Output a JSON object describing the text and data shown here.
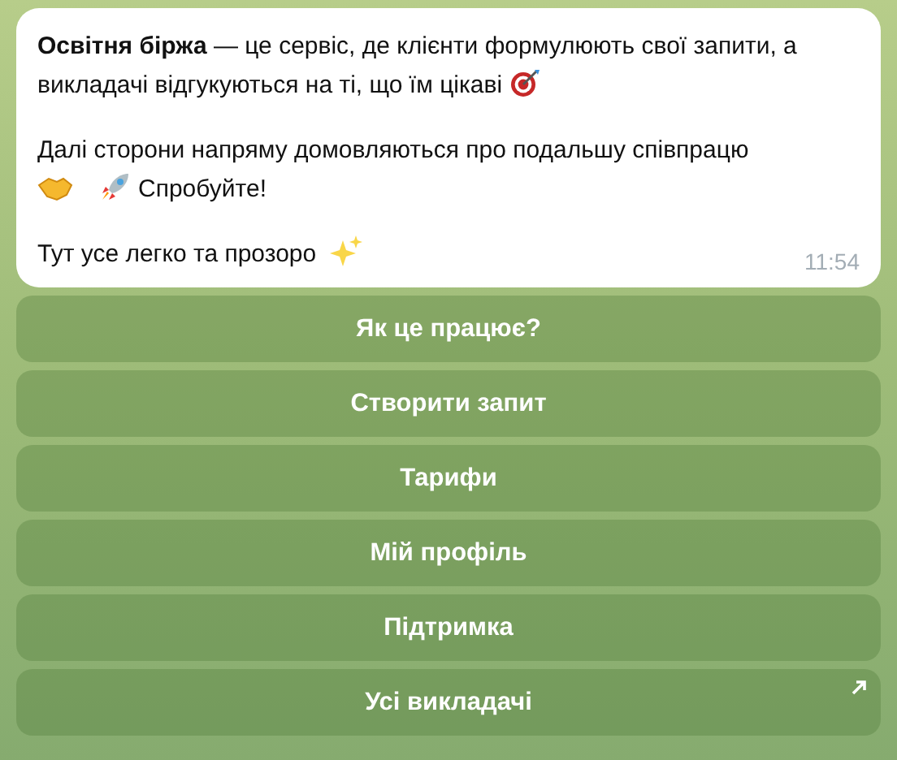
{
  "message": {
    "paragraphs": [
      {
        "text": "**Освітня біржа** — це сервіс, де клієнти формулюють свої запити, а викладачі відгукуються на ті, що їм цікаві"
      },
      {
        "text": "Далі сторони напряму домовляються про подальшу співпрацю",
        "tail": "Спробуйте!"
      },
      {
        "text": "Тут усе легко та прозоро"
      }
    ],
    "time": "11:54"
  },
  "buttons": [
    {
      "label": "Як це працює?",
      "kind": "callback"
    },
    {
      "label": "Створити запит",
      "kind": "callback"
    },
    {
      "label": "Тарифи",
      "kind": "callback"
    },
    {
      "label": "Мій профіль",
      "kind": "callback"
    },
    {
      "label": "Підтримка",
      "kind": "callback"
    },
    {
      "label": "Усі викладачі",
      "kind": "url"
    }
  ]
}
